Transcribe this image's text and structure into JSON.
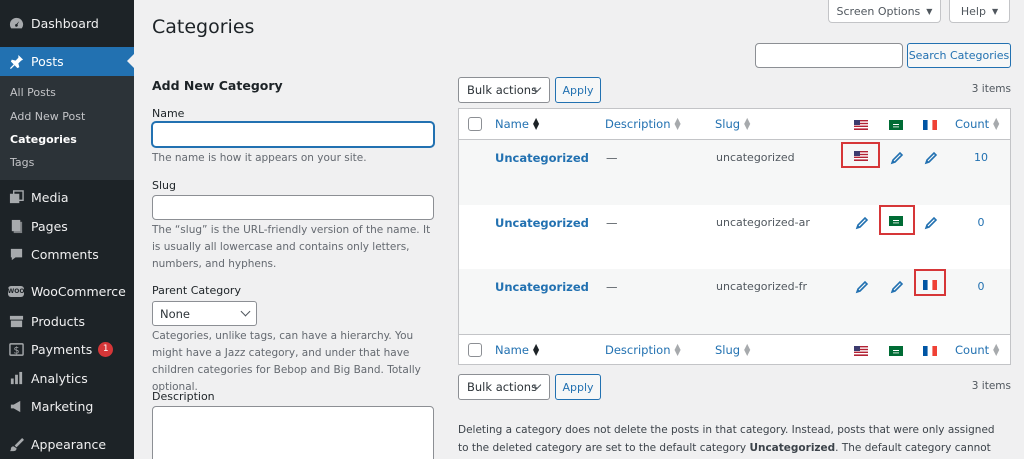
{
  "sidebar": {
    "items": [
      {
        "label": "Dashboard",
        "icon": "dashboard-icon"
      },
      {
        "label": "Posts",
        "icon": "pushpin-icon"
      },
      {
        "label": "Media",
        "icon": "media-icon"
      },
      {
        "label": "Pages",
        "icon": "pages-icon"
      },
      {
        "label": "Comments",
        "icon": "comment-icon"
      },
      {
        "label": "WooCommerce",
        "icon": "woocommerce-icon",
        "icon_text": "WOO"
      },
      {
        "label": "Products",
        "icon": "archive-icon"
      },
      {
        "label": "Payments",
        "icon": "payments-icon",
        "badge": "1"
      },
      {
        "label": "Analytics",
        "icon": "analytics-icon"
      },
      {
        "label": "Marketing",
        "icon": "megaphone-icon"
      },
      {
        "label": "Appearance",
        "icon": "brush-icon"
      }
    ],
    "submenu": [
      "All Posts",
      "Add New Post",
      "Categories",
      "Tags"
    ]
  },
  "top": {
    "screen_options": "Screen Options",
    "help": "Help"
  },
  "page_title": "Categories",
  "search": {
    "button": "Search Categories",
    "value": ""
  },
  "form": {
    "heading": "Add New Category",
    "name_label": "Name",
    "name_value": "",
    "name_desc": "The name is how it appears on your site.",
    "slug_label": "Slug",
    "slug_value": "",
    "slug_desc": "The “slug” is the URL-friendly version of the name. It is usually all lowercase and contains only letters, numbers, and hyphens.",
    "parent_label": "Parent Category",
    "parent_value": "None",
    "parent_desc": "Categories, unlike tags, can have a hierarchy. You might have a Jazz category, and under that have children categories for Bebop and Big Band. Totally optional.",
    "description_label": "Description"
  },
  "list": {
    "bulk_actions": "Bulk actions",
    "apply": "Apply",
    "items_count": "3 items",
    "columns": {
      "name": "Name",
      "description": "Description",
      "slug": "Slug",
      "count": "Count"
    },
    "rows": [
      {
        "name": "Uncategorized",
        "description": "—",
        "slug": "uncategorized",
        "count": "10"
      },
      {
        "name": "Uncategorized",
        "description": "—",
        "slug": "uncategorized-ar",
        "count": "0"
      },
      {
        "name": "Uncategorized",
        "description": "—",
        "slug": "uncategorized-fr",
        "count": "0"
      }
    ],
    "footer": {
      "before": "Deleting a category does not delete the posts in that category. Instead, posts that were only assigned to the deleted category are set to the default category ",
      "bold": "Uncategorized",
      "after": ". The default category cannot be deleted."
    }
  },
  "colors": {
    "accent": "#2271b1",
    "sidebar_bg": "#1d2327",
    "highlight": "#d63638"
  }
}
